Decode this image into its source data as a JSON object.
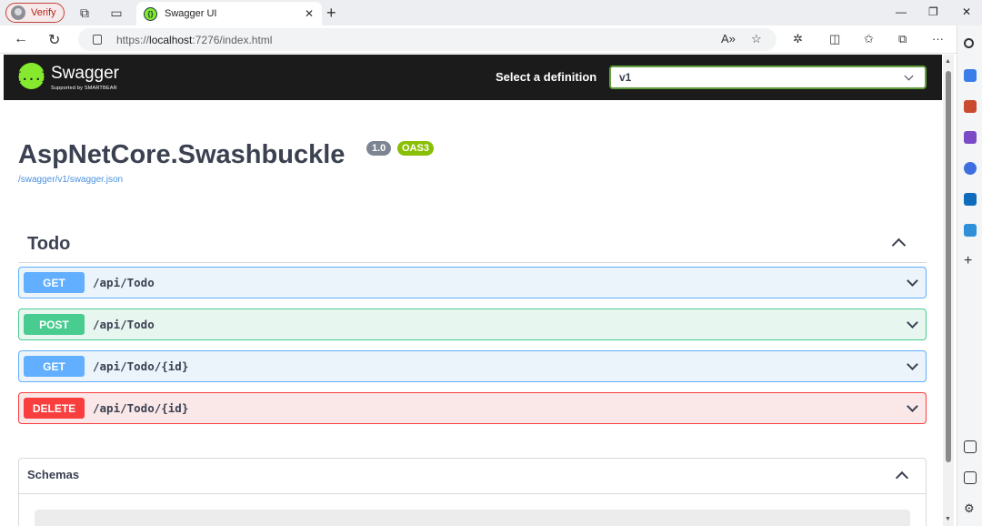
{
  "browser": {
    "profile_label": "Verify",
    "tab_title": "Swagger UI",
    "tab_favicon": "{}",
    "url_prefix": "https://",
    "url_host": "localhost",
    "url_rest": ":7276/index.html",
    "icons": [
      "person-icon",
      "workspaces-icon",
      "tab-actions-icon",
      "close-icon",
      "plus-icon",
      "minimize-icon",
      "maximize-icon",
      "window-close-icon",
      "back-icon",
      "refresh-icon",
      "lock-icon",
      "read-aloud-icon",
      "favorite-icon",
      "extensions-icon",
      "split-screen-icon",
      "favorites-icon",
      "collections-icon",
      "more-icon",
      "copilot-icon"
    ]
  },
  "swagger": {
    "brand": "Swagger",
    "sub_brand": "Supported by SMARTBEAR",
    "logo_glyph": "{...}",
    "select_label": "Select a definition",
    "select_value": "v1",
    "api_title": "AspNetCore.Swashbuckle",
    "version": "1.0",
    "oas": "OAS3",
    "spec_link": "/swagger/v1/swagger.json",
    "tag": "Todo",
    "operations": [
      {
        "method": "GET",
        "path": "/api/Todo"
      },
      {
        "method": "POST",
        "path": "/api/Todo"
      },
      {
        "method": "GET",
        "path": "/api/Todo/{id}"
      },
      {
        "method": "DELETE",
        "path": "/api/Todo/{id}"
      }
    ],
    "schemas_title": "Schemas"
  },
  "colors": {
    "get": "#61affe",
    "post": "#49cc90",
    "delete": "#f93e3e",
    "header_bg": "#1b1b1b",
    "swagger_green": "#85ea2d",
    "oas_badge": "#89bf04"
  }
}
